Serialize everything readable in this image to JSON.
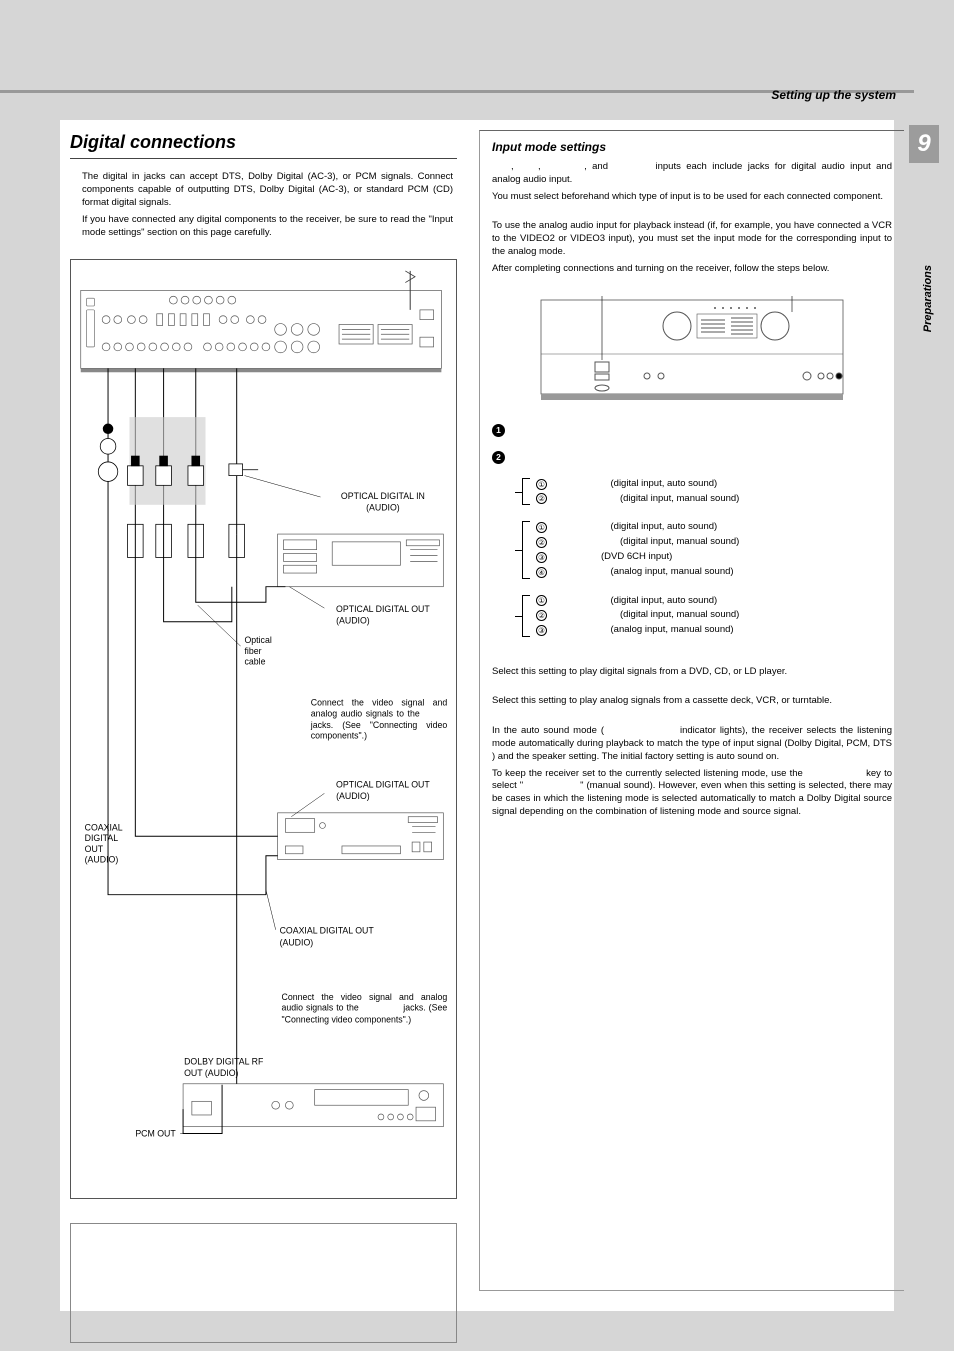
{
  "header": {
    "section": "Setting up the system",
    "page_number": "9",
    "side_tab": "Preparations"
  },
  "left": {
    "title": "Digital connections",
    "p1": "The digital in jacks can accept DTS, Dolby Digital (AC-3), or PCM signals. Connect components capable of outputting DTS, Dolby Digital (AC-3), or standard PCM (CD) format digital signals.",
    "p2": "If you have connected any digital components to the receiver, be sure to read the \"Input mode settings\" section on this page carefully.",
    "labels": {
      "opt_in": "OPTICAL DIGITAL IN (AUDIO)",
      "opt_out1": "OPTICAL DIGITAL OUT (AUDIO)",
      "fiber": "Optical fiber cable",
      "note1a": "Connect the video signal and analog audio signals to the",
      "note1b": "jacks. (See \"Connecting video components\".)",
      "opt_out2": "OPTICAL DIGITAL OUT (AUDIO)",
      "coax_out_l": "COAXIAL DIGITAL OUT (AUDIO)",
      "coax_out": "COAXIAL DIGITAL OUT (AUDIO)",
      "note2a": "Connect the video signal and analog audio signals to the",
      "note2b": "jacks. (See \"Connecting video components\".)",
      "rf": "DOLBY DIGITAL RF OUT (AUDIO)",
      "pcm": "PCM OUT"
    }
  },
  "right": {
    "title": "Input mode settings",
    "intro1a": ", and",
    "intro1b": "inputs each include jacks for digital audio input and analog audio input.",
    "intro2": "You must select beforehand which type of input is to be used for each connected component.",
    "p1": "To use the analog audio input for playback instead (if, for example, you have connected a VCR to the VIDEO2 or VIDEO3 input), you must set the input mode for the corresponding input to the analog mode.",
    "p2": "After completing connections and turning on the receiver, follow the steps below.",
    "step1": "1",
    "step2": "2",
    "groups": [
      {
        "items": [
          {
            "n": "①",
            "t": "(digital input, auto sound)"
          },
          {
            "n": "②",
            "t": "(digital input, manual sound)"
          }
        ]
      },
      {
        "items": [
          {
            "n": "①",
            "t": "(digital input, auto sound)"
          },
          {
            "n": "②",
            "t": "(digital input, manual sound)"
          },
          {
            "n": "③",
            "t": "(DVD 6CH input)"
          },
          {
            "n": "④",
            "t": "(analog input, manual sound)"
          }
        ]
      },
      {
        "items": [
          {
            "n": "①",
            "t": "(digital input, auto sound)"
          },
          {
            "n": "②",
            "t": "(digital input, manual sound)"
          },
          {
            "n": "③",
            "t": "(analog input, manual sound)"
          }
        ]
      }
    ],
    "dig_desc": "Select this setting to play digital signals from a DVD, CD, or LD player.",
    "ana_desc": "Select this setting to play analog signals from a cassette deck, VCR, or turntable.",
    "auto_a": "In the auto sound mode (",
    "auto_b": "indicator lights), the receiver selects the listening mode automatically during playback to match the type of input signal (Dolby Digital, PCM, DTS ) and the speaker setting. The initial factory setting is auto sound on.",
    "auto_c1": "To keep the receiver set to the currently selected listening mode, use the",
    "auto_c2": "key to select \"",
    "auto_c3": "\" (manual sound). However, even when this setting is selected, there may be cases in which the listening mode is selected automatically to match a Dolby Digital source signal depending on the combination of listening mode and source signal."
  }
}
